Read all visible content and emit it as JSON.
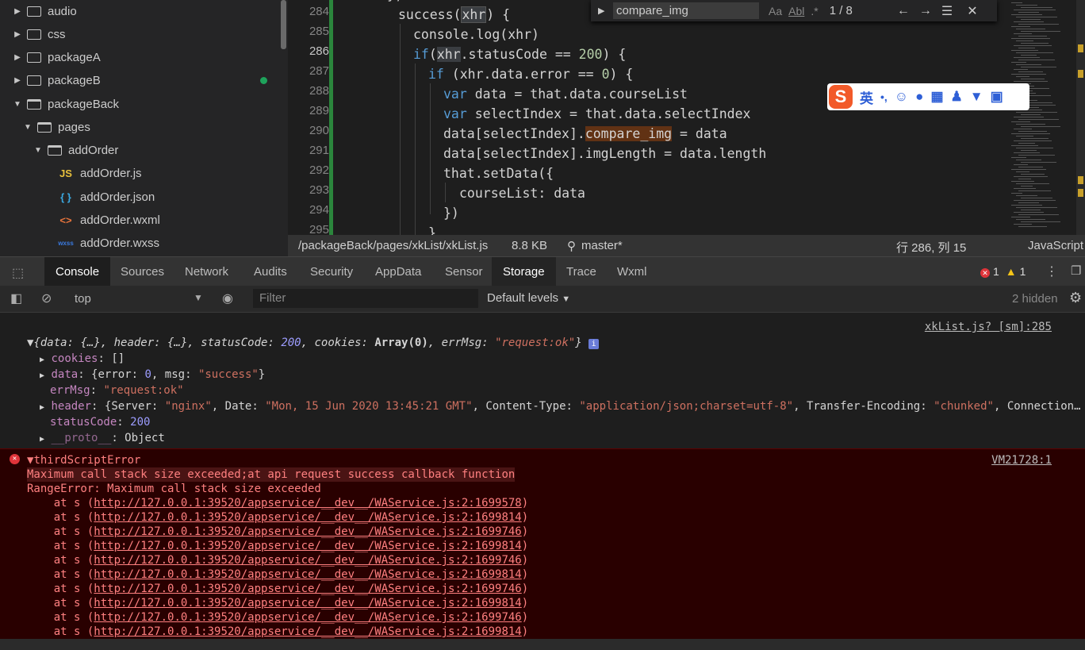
{
  "file_tree": {
    "items": [
      {
        "label": "audio",
        "type": "folder",
        "expanded": false,
        "depth": 0
      },
      {
        "label": "css",
        "type": "folder",
        "expanded": false,
        "depth": 0
      },
      {
        "label": "packageA",
        "type": "folder",
        "expanded": false,
        "depth": 0
      },
      {
        "label": "packageB",
        "type": "folder",
        "expanded": false,
        "depth": 0,
        "modified": true
      },
      {
        "label": "packageBack",
        "type": "folder",
        "expanded": true,
        "depth": 0
      },
      {
        "label": "pages",
        "type": "folder",
        "expanded": true,
        "depth": 1
      },
      {
        "label": "addOrder",
        "type": "folder",
        "expanded": true,
        "depth": 2
      },
      {
        "label": "addOrder.js",
        "type": "file",
        "icon": "JS",
        "icon_color": "#e8c13c",
        "depth": 3
      },
      {
        "label": "addOrder.json",
        "type": "file",
        "icon": "{ }",
        "icon_color": "#3aa8e0",
        "depth": 3
      },
      {
        "label": "addOrder.wxml",
        "type": "file",
        "icon": "<>",
        "icon_color": "#e8743c",
        "depth": 3
      },
      {
        "label": "addOrder.wxss",
        "type": "file",
        "icon": "wxss",
        "icon_color": "#3a7ae0",
        "depth": 3
      }
    ]
  },
  "editor": {
    "line_numbers": [
      "284",
      "285",
      "286",
      "287",
      "288",
      "289",
      "290",
      "291",
      "292",
      "293",
      "294",
      "295"
    ],
    "current_line": "286",
    "find_widget": {
      "query": "compare_img",
      "match_case": "Aa",
      "whole_word": "Abl",
      "regex": ".*",
      "count": "1 / 8"
    }
  },
  "ime_bar": {
    "logo": "S",
    "mode": "英",
    "punct": "•,",
    "icons": [
      "emoji-icon",
      "mic-icon",
      "keyboard-icon",
      "user-icon",
      "shirt-icon",
      "grid-icon"
    ]
  },
  "status_bar": {
    "path": "/packageBack/pages/xkList/xkList.js",
    "size": "8.8 KB",
    "branch": "master*",
    "position": "行 286, 列 15",
    "language": "JavaScript"
  },
  "devtools": {
    "tabs": [
      "Console",
      "Sources",
      "Network",
      "Audits",
      "Security",
      "AppData",
      "Sensor",
      "Storage",
      "Trace",
      "Wxml"
    ],
    "active_tab": "Console",
    "error_count": "1",
    "warning_count": "1"
  },
  "console_toolbar": {
    "context": "top",
    "filter_placeholder": "Filter",
    "levels": "Default levels",
    "hidden": "2 hidden"
  },
  "console": {
    "log_source": "xkList.js? [sm]:285",
    "error_source": "VM21728:1",
    "error_title": "thirdScriptError",
    "error_message": "Maximum call stack size exceeded;at api request success callback function",
    "range_error": "RangeError: Maximum call stack size exceeded",
    "stack_prefix": "    at s (",
    "stack_suffix": ")",
    "stack": [
      "http://127.0.0.1:39520/appservice/__dev__/WAService.js:2:1699578",
      "http://127.0.0.1:39520/appservice/__dev__/WAService.js:2:1699814",
      "http://127.0.0.1:39520/appservice/__dev__/WAService.js:2:1699746",
      "http://127.0.0.1:39520/appservice/__dev__/WAService.js:2:1699814",
      "http://127.0.0.1:39520/appservice/__dev__/WAService.js:2:1699746",
      "http://127.0.0.1:39520/appservice/__dev__/WAService.js:2:1699814",
      "http://127.0.0.1:39520/appservice/__dev__/WAService.js:2:1699746",
      "http://127.0.0.1:39520/appservice/__dev__/WAService.js:2:1699814",
      "http://127.0.0.1:39520/appservice/__dev__/WAService.js:2:1699746",
      "http://127.0.0.1:39520/appservice/__dev__/WAService.js:2:1699814"
    ]
  }
}
